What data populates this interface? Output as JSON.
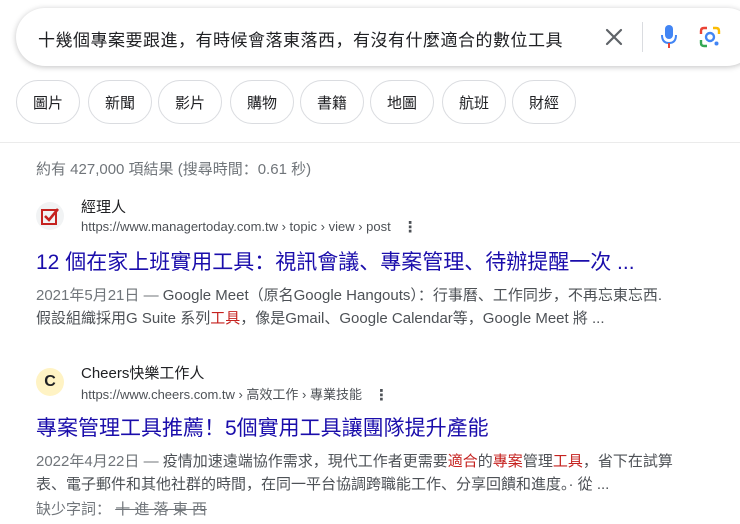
{
  "search": {
    "query": "十幾個專案要跟進，有時候會落東落西，有沒有什麼適合的數位工具",
    "icons": {
      "clear": "close-icon",
      "voice": "mic-icon",
      "lens": "lens-icon"
    },
    "colors": {
      "mic_blue": "#4285f4",
      "mic_red": "#ea4335",
      "lens_green": "#34a853",
      "lens_yellow": "#fbbc04"
    }
  },
  "chips": [
    "圖片",
    "新聞",
    "影片",
    "購物",
    "書籍",
    "地圖",
    "航班",
    "財經"
  ],
  "stats": "約有 427,000 項結果 (搜尋時間：0.61 秒)",
  "results": [
    {
      "site_name": "經理人",
      "url": "https://www.managertoday.com.tw › topic › view › post",
      "title": "12 個在家上班實用工具：視訊會議、專案管理、待辦提醒一次 ...",
      "date": "2021年5月21日 —",
      "snippet_line1": "Google Meet（原名Google Hangouts）：行事曆、工作同步，不再忘東忘西.",
      "snippet_line2_a": "假設組織採用G Suite 系列",
      "snippet_line2_hl": "工具",
      "snippet_line2_b": "，像是Gmail、Google Calendar等，Google Meet 將 ...",
      "favicon_color": "#c5221f"
    },
    {
      "site_name": "Cheers快樂工作人",
      "url": "https://www.cheers.com.tw › 高效工作 › 專業技能",
      "title": "專案管理工具推薦！5個實用工具讓團隊提升產能",
      "date": "2022年4月22日 —",
      "snippet_line1_a": "疫情加速遠端協作需求，現代工作者更需要",
      "snippet_line1_hl1": "適合",
      "snippet_line1_b": "的",
      "snippet_line1_hl2": "專案",
      "snippet_line1_c": "管理",
      "snippet_line1_hl3": "工具",
      "snippet_line1_d": "，省下在試算",
      "snippet_line2": "表、電子郵件和其他社群的時間，在同一平台協調跨職能工作、分享回饋和進度。· 從 ...",
      "missing_label": "缺少字詞：",
      "missing_terms": "十 進 落 東 西",
      "favicon_letter": "C",
      "favicon_color": "#f4b400"
    }
  ]
}
